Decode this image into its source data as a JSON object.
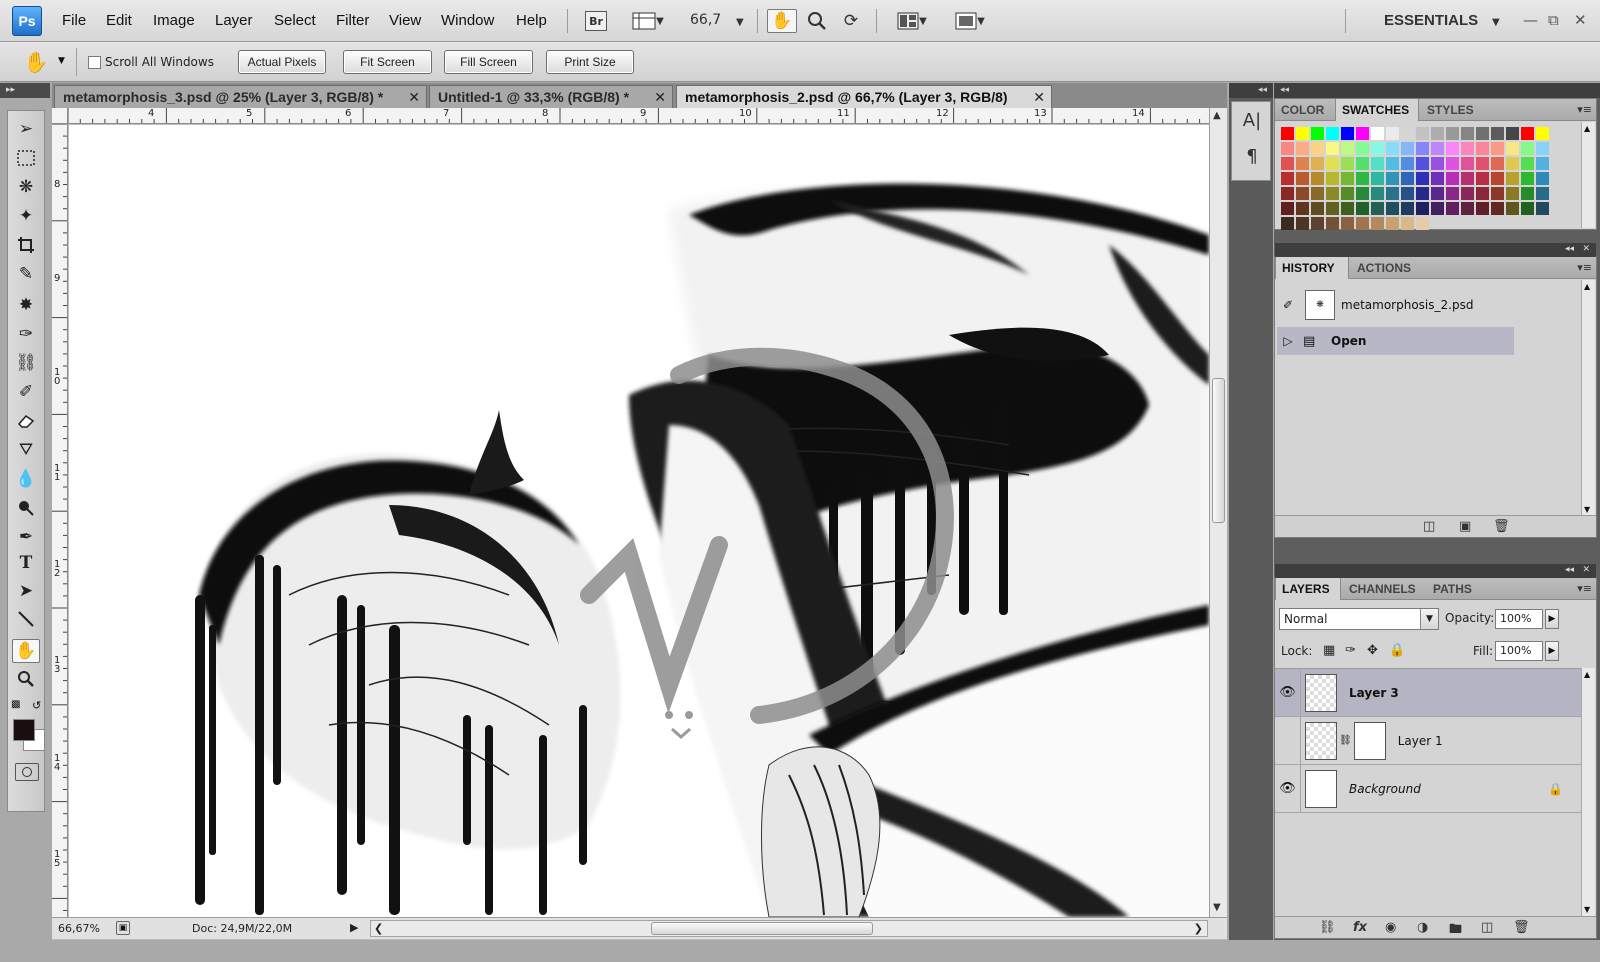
{
  "app": {
    "logo": "Ps"
  },
  "menu": [
    "File",
    "Edit",
    "Image",
    "Layer",
    "Select",
    "Filter",
    "View",
    "Window",
    "Help"
  ],
  "menubar": {
    "bridge_label": "Br",
    "zoom_value": "66,7",
    "workspace": "ESSENTIALS"
  },
  "options": {
    "scroll_all_windows": "Scroll All Windows",
    "buttons": [
      "Actual Pixels",
      "Fit Screen",
      "Fill Screen",
      "Print Size"
    ]
  },
  "tabs": [
    {
      "label": "metamorphosis_3.psd @ 25% (Layer 3, RGB/8) *",
      "active": false
    },
    {
      "label": "Untitled-1 @ 33,3% (RGB/8) *",
      "active": false
    },
    {
      "label": "metamorphosis_2.psd @ 66,7% (Layer 3, RGB/8)",
      "active": true
    }
  ],
  "ruler": {
    "horizontal": [
      "4",
      "5",
      "6",
      "7",
      "8",
      "9",
      "10",
      "11",
      "12",
      "13",
      "14"
    ],
    "vertical": [
      "8",
      "9",
      "1\n0",
      "1\n1",
      "1\n2",
      "1\n3",
      "1\n4",
      "1\n5"
    ]
  },
  "status": {
    "zoom": "66,67%",
    "doc": "Doc: 24,9M/22,0M"
  },
  "swatches_panel": {
    "tabs": [
      "COLOR",
      "SWATCHES",
      "STYLES"
    ],
    "active": "SWATCHES"
  },
  "history_panel": {
    "tabs": [
      "HISTORY",
      "ACTIONS"
    ],
    "snapshot": "metamorphosis_2.psd",
    "states": [
      "Open"
    ]
  },
  "layers_panel": {
    "tabs": [
      "LAYERS",
      "CHANNELS",
      "PATHS"
    ],
    "blend_mode": "Normal",
    "opacity_label": "Opacity:",
    "opacity": "100%",
    "lock_label": "Lock:",
    "fill_label": "Fill:",
    "fill": "100%",
    "layers": [
      {
        "name": "Layer 3",
        "visible": true,
        "selected": true
      },
      {
        "name": "Layer 1",
        "visible": false,
        "selected": false
      },
      {
        "name": "Background",
        "visible": true,
        "selected": false
      }
    ]
  },
  "colors": {
    "foreground": "#1a0e0e",
    "background": "#ffffff",
    "selection": "#b4b4c2"
  },
  "icons": [
    "move-tool-icon",
    "marquee-tool-icon",
    "lasso-tool-icon",
    "magic-wand-icon",
    "crop-tool-icon",
    "eyedropper-icon",
    "healing-brush-icon",
    "brush-tool-icon",
    "clone-stamp-icon",
    "history-brush-icon",
    "eraser-icon",
    "paint-bucket-icon",
    "blur-tool-icon",
    "dodge-tool-icon",
    "pen-tool-icon",
    "type-tool-icon",
    "path-selection-icon",
    "line-tool-icon",
    "hand-tool-icon",
    "zoom-tool-icon"
  ]
}
